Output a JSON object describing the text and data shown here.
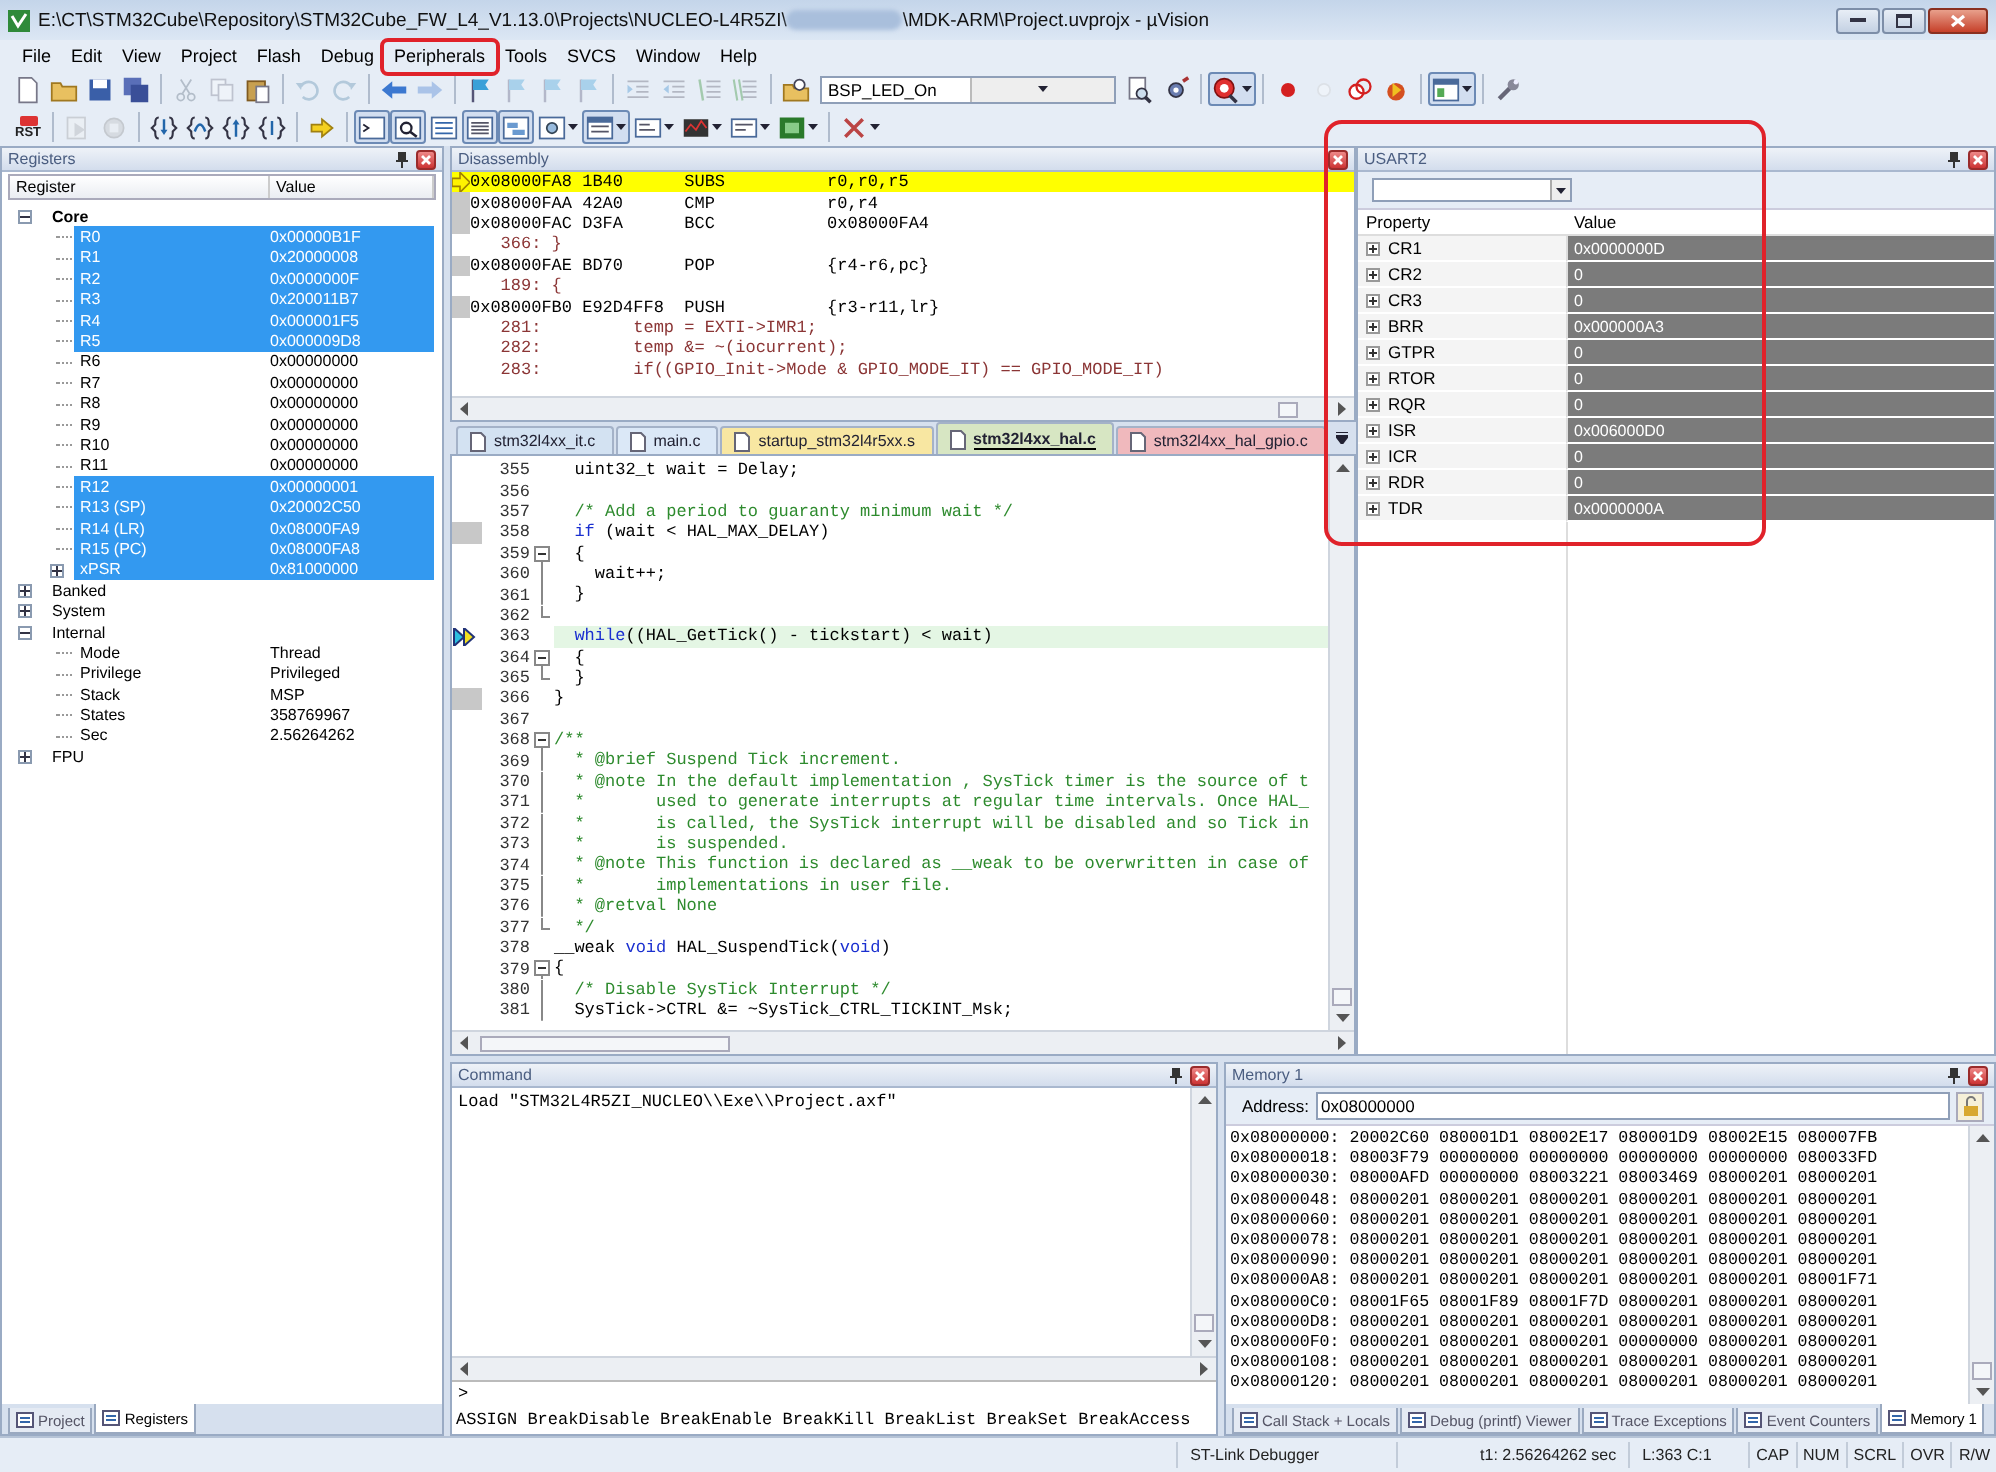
{
  "window": {
    "title_start": "E:\\CT\\STM32Cube\\Repository\\STM32Cube_FW_L4_V1.13.0\\Projects\\NUCLEO-L4R5ZI\\",
    "title_end": "\\MDK-ARM\\Project.uvprojx - µVision"
  },
  "menu": [
    {
      "label": "File",
      "highlighted": false
    },
    {
      "label": "Edit",
      "highlighted": false
    },
    {
      "label": "View",
      "highlighted": false
    },
    {
      "label": "Project",
      "highlighted": false
    },
    {
      "label": "Flash",
      "highlighted": false
    },
    {
      "label": "Debug",
      "highlighted": false
    },
    {
      "label": "Peripherals",
      "highlighted": true
    },
    {
      "label": "Tools",
      "highlighted": false
    },
    {
      "label": "SVCS",
      "highlighted": false
    },
    {
      "label": "Window",
      "highlighted": false
    },
    {
      "label": "Help",
      "highlighted": false
    }
  ],
  "toolbar_1": [
    {
      "kind": "file",
      "disabled": false,
      "pressed": false,
      "menu": false
    },
    {
      "kind": "folder",
      "disabled": false,
      "pressed": false,
      "menu": false
    },
    {
      "kind": "save",
      "disabled": false,
      "pressed": false,
      "menu": false
    },
    {
      "kind": "saveall",
      "disabled": false,
      "pressed": false,
      "menu": false
    },
    {
      "kind": "separator"
    },
    {
      "kind": "cut",
      "disabled": true,
      "pressed": false,
      "menu": false
    },
    {
      "kind": "copy",
      "disabled": true,
      "pressed": false,
      "menu": false
    },
    {
      "kind": "paste",
      "disabled": false,
      "pressed": false,
      "menu": false
    },
    {
      "kind": "separator"
    },
    {
      "kind": "undo",
      "disabled": true,
      "pressed": false,
      "menu": false
    },
    {
      "kind": "redo",
      "disabled": true,
      "pressed": false,
      "menu": false
    },
    {
      "kind": "separator"
    },
    {
      "kind": "back",
      "disabled": false,
      "pressed": false,
      "menu": false
    },
    {
      "kind": "forward",
      "disabled": true,
      "pressed": false,
      "menu": false
    },
    {
      "kind": "separator"
    },
    {
      "kind": "flag",
      "disabled": false,
      "pressed": false,
      "menu": false
    },
    {
      "kind": "flag",
      "disabled": true,
      "pressed": false,
      "menu": false
    },
    {
      "kind": "flag",
      "disabled": true,
      "pressed": false,
      "menu": false
    },
    {
      "kind": "flag",
      "disabled": true,
      "pressed": false,
      "menu": false
    },
    {
      "kind": "separator"
    },
    {
      "kind": "indent",
      "disabled": true,
      "pressed": false,
      "menu": false
    },
    {
      "kind": "outdent",
      "disabled": true,
      "pressed": false,
      "menu": false
    },
    {
      "kind": "comment",
      "disabled": true,
      "pressed": false,
      "menu": false
    },
    {
      "kind": "uncomment",
      "disabled": true,
      "pressed": false,
      "menu": false
    },
    {
      "kind": "separator"
    },
    {
      "kind": "findfiles",
      "disabled": false,
      "pressed": false,
      "menu": false
    },
    {
      "kind": "combo",
      "value": "BSP_LED_On"
    },
    {
      "kind": "find",
      "disabled": false,
      "pressed": false,
      "menu": false
    },
    {
      "kind": "gear",
      "disabled": false,
      "pressed": false,
      "menu": false
    },
    {
      "kind": "separator"
    },
    {
      "kind": "debug",
      "disabled": false,
      "pressed": true,
      "menu": true
    },
    {
      "kind": "separator"
    },
    {
      "kind": "breakpoint",
      "disabled": false,
      "pressed": false,
      "menu": false
    },
    {
      "kind": "breakpointoff",
      "disabled": true,
      "pressed": false,
      "menu": false
    },
    {
      "kind": "breakpointkill",
      "disabled": false,
      "pressed": false,
      "menu": false
    },
    {
      "kind": "breakpointclear",
      "disabled": false,
      "pressed": false,
      "menu": false
    },
    {
      "kind": "separator"
    },
    {
      "kind": "window",
      "disabled": false,
      "pressed": true,
      "menu": true
    },
    {
      "kind": "separator"
    },
    {
      "kind": "wrench",
      "disabled": false,
      "pressed": false,
      "menu": false
    }
  ],
  "toolbar_2": [
    {
      "kind": "reset",
      "label": "RST",
      "disabled": false,
      "pressed": false,
      "menu": false
    },
    {
      "kind": "separator"
    },
    {
      "kind": "run",
      "disabled": true,
      "pressed": false,
      "menu": false
    },
    {
      "kind": "stop",
      "disabled": true,
      "pressed": false,
      "menu": false
    },
    {
      "kind": "separator"
    },
    {
      "kind": "stepinto",
      "disabled": false,
      "pressed": false,
      "menu": false
    },
    {
      "kind": "stepover",
      "disabled": false,
      "pressed": false,
      "menu": false
    },
    {
      "kind": "stepout",
      "disabled": false,
      "pressed": false,
      "menu": false
    },
    {
      "kind": "runtocursor",
      "disabled": false,
      "pressed": false,
      "menu": false
    },
    {
      "kind": "separator"
    },
    {
      "kind": "nextstatement",
      "disabled": false,
      "pressed": false,
      "menu": false
    },
    {
      "kind": "separator"
    },
    {
      "kind": "cmdwindow",
      "disabled": false,
      "pressed": true,
      "menu": false
    },
    {
      "kind": "disasmwindow",
      "disabled": false,
      "pressed": true,
      "menu": false
    },
    {
      "kind": "symbols",
      "disabled": false,
      "pressed": false,
      "menu": false
    },
    {
      "kind": "regwindow",
      "disabled": false,
      "pressed": true,
      "menu": false
    },
    {
      "kind": "callstack",
      "disabled": false,
      "pressed": true,
      "menu": false
    },
    {
      "kind": "watch",
      "disabled": false,
      "pressed": false,
      "menu": true
    },
    {
      "kind": "memwindow",
      "disabled": false,
      "pressed": true,
      "menu": true
    },
    {
      "kind": "serial",
      "disabled": false,
      "pressed": false,
      "menu": true
    },
    {
      "kind": "analysis",
      "disabled": false,
      "pressed": false,
      "menu": true
    },
    {
      "kind": "trace",
      "disabled": false,
      "pressed": false,
      "menu": true
    },
    {
      "kind": "sysviewer",
      "disabled": false,
      "pressed": false,
      "menu": true
    },
    {
      "kind": "separator"
    },
    {
      "kind": "toolbox",
      "disabled": false,
      "pressed": false,
      "menu": true
    }
  ],
  "registers": {
    "title": "Registers",
    "columns": [
      "Register",
      "Value"
    ],
    "groups": [
      {
        "name": "Core",
        "expanded": true,
        "bold": true,
        "children": [
          {
            "name": "R0",
            "value": "0x00000B1F",
            "selected": true,
            "expandable": false
          },
          {
            "name": "R1",
            "value": "0x20000008",
            "selected": true,
            "expandable": false
          },
          {
            "name": "R2",
            "value": "0x0000000F",
            "selected": true,
            "expandable": false
          },
          {
            "name": "R3",
            "value": "0x200011B7",
            "selected": true,
            "expandable": false
          },
          {
            "name": "R4",
            "value": "0x000001F5",
            "selected": true,
            "expandable": false
          },
          {
            "name": "R5",
            "value": "0x000009D8",
            "selected": true,
            "expandable": false
          },
          {
            "name": "R6",
            "value": "0x00000000",
            "selected": false,
            "expandable": false
          },
          {
            "name": "R7",
            "value": "0x00000000",
            "selected": false,
            "expandable": false
          },
          {
            "name": "R8",
            "value": "0x00000000",
            "selected": false,
            "expandable": false
          },
          {
            "name": "R9",
            "value": "0x00000000",
            "selected": false,
            "expandable": false
          },
          {
            "name": "R10",
            "value": "0x00000000",
            "selected": false,
            "expandable": false
          },
          {
            "name": "R11",
            "value": "0x00000000",
            "selected": false,
            "expandable": false
          },
          {
            "name": "R12",
            "value": "0x00000001",
            "selected": true,
            "expandable": false
          },
          {
            "name": "R13 (SP)",
            "value": "0x20002C50",
            "selected": true,
            "expandable": false
          },
          {
            "name": "R14 (LR)",
            "value": "0x08000FA9",
            "selected": true,
            "expandable": false
          },
          {
            "name": "R15 (PC)",
            "value": "0x08000FA8",
            "selected": true,
            "expandable": false
          },
          {
            "name": "xPSR",
            "value": "0x81000000",
            "selected": true,
            "expandable": true
          }
        ]
      },
      {
        "name": "Banked",
        "expanded": false,
        "bold": false
      },
      {
        "name": "System",
        "expanded": false,
        "bold": false
      },
      {
        "name": "Internal",
        "expanded": true,
        "bold": false,
        "children": [
          {
            "name": "Mode",
            "value": "Thread",
            "selected": false,
            "expandable": false
          },
          {
            "name": "Privilege",
            "value": "Privileged",
            "selected": false,
            "expandable": false
          },
          {
            "name": "Stack",
            "value": "MSP",
            "selected": false,
            "expandable": false
          },
          {
            "name": "States",
            "value": "358769967",
            "selected": false,
            "expandable": false
          },
          {
            "name": "Sec",
            "value": "2.56264262",
            "selected": false,
            "expandable": false
          }
        ]
      },
      {
        "name": "FPU",
        "expanded": false,
        "bold": false
      }
    ],
    "tabs": [
      {
        "label": "Project",
        "selected": false
      },
      {
        "label": "Registers",
        "selected": true
      }
    ]
  },
  "disassembly": {
    "title": "Disassembly",
    "lines": [
      {
        "kind": "instruction",
        "text": "0x08000FA8 1B40      SUBS          r0,r0,r5",
        "current": true
      },
      {
        "kind": "instruction",
        "text": "0x08000FAA 42A0      CMP           r0,r4",
        "current": false
      },
      {
        "kind": "instruction",
        "text": "0x08000FAC D3FA      BCC           0x08000FA4",
        "current": false
      },
      {
        "kind": "source",
        "text": "   366: }"
      },
      {
        "kind": "instruction",
        "text": "0x08000FAE BD70      POP           {r4-r6,pc}",
        "current": false
      },
      {
        "kind": "source",
        "text": "   189: {"
      },
      {
        "kind": "instruction",
        "text": "0x08000FB0 E92D4FF8  PUSH          {r3-r11,lr}",
        "current": false
      },
      {
        "kind": "source",
        "text": "   281:         temp = EXTI->IMR1;"
      },
      {
        "kind": "source",
        "text": "   282:         temp &= ~(iocurrent);"
      },
      {
        "kind": "source",
        "text": "   283:         if((GPIO_Init->Mode & GPIO_MODE_IT) == GPIO_MODE_IT)"
      }
    ]
  },
  "editor": {
    "tabs": [
      {
        "label": "stm32l4xx_it.c",
        "selected": false,
        "color": "#d3e2f2"
      },
      {
        "label": "main.c",
        "selected": false,
        "color": "#dbe8f7"
      },
      {
        "label": "startup_stm32l4r5xx.s",
        "selected": false,
        "color": "#f8e7a2"
      },
      {
        "label": "stm32l4xx_hal.c",
        "selected": true,
        "color": "#d7e6c3"
      },
      {
        "label": "stm32l4xx_hal_gpio.c",
        "selected": false,
        "color": "#f0b9bd"
      }
    ],
    "lines": [
      {
        "number": "355",
        "kind": "code",
        "text": "  uint32_t wait = Delay;",
        "fold_start": false,
        "fold_line": false,
        "fold_end": false,
        "executed": false,
        "current": false
      },
      {
        "number": "356",
        "fold_start": false,
        "fold_line": false,
        "fold_end": false,
        "executed": false,
        "current": false
      },
      {
        "number": "357",
        "kind": "comment",
        "text": "  /* Add a period to guaranty minimum wait */",
        "fold_start": false,
        "fold_line": false,
        "fold_end": false,
        "executed": false,
        "current": false
      },
      {
        "number": "358",
        "kind": "code",
        "parts": [
          {
            "text": "  if",
            "kind": "keyword"
          },
          {
            "text": " (wait < HAL_MAX_DELAY)",
            "kind": "plain"
          }
        ],
        "fold_start": false,
        "fold_line": false,
        "fold_end": false,
        "executed": true,
        "current": false
      },
      {
        "number": "359",
        "kind": "code",
        "text": "  {",
        "fold_start": true,
        "fold_line": false,
        "fold_end": false,
        "executed": false,
        "current": false
      },
      {
        "number": "360",
        "kind": "code",
        "text": "    wait++;",
        "fold_start": false,
        "fold_line": true,
        "fold_end": false,
        "executed": false,
        "current": false
      },
      {
        "number": "361",
        "kind": "code",
        "text": "  }",
        "fold_start": false,
        "fold_line": true,
        "fold_end": false,
        "executed": false,
        "current": false
      },
      {
        "number": "362",
        "fold_start": false,
        "fold_line": false,
        "fold_end": true,
        "executed": false,
        "current": false
      },
      {
        "number": "363",
        "kind": "code",
        "parts": [
          {
            "text": "  while",
            "kind": "keyword"
          },
          {
            "text": "((HAL_GetTick() - tickstart) < wait)",
            "kind": "plain"
          }
        ],
        "fold_start": false,
        "fold_line": false,
        "fold_end": false,
        "executed": false,
        "current": true
      },
      {
        "number": "364",
        "kind": "code",
        "text": "  {",
        "fold_start": true,
        "fold_line": false,
        "fold_end": false,
        "executed": false,
        "current": false
      },
      {
        "number": "365",
        "kind": "code",
        "text": "  }",
        "fold_start": false,
        "fold_line": false,
        "fold_end": true,
        "executed": false,
        "current": false
      },
      {
        "number": "366",
        "kind": "code",
        "text": "}",
        "fold_start": false,
        "fold_line": false,
        "fold_end": false,
        "executed": true,
        "current": false
      },
      {
        "number": "367",
        "fold_start": false,
        "fold_line": false,
        "fold_end": false,
        "executed": false,
        "current": false
      },
      {
        "number": "368",
        "kind": "comment",
        "text": "/**",
        "fold_start": true,
        "fold_line": false,
        "fold_end": false,
        "executed": false,
        "current": false
      },
      {
        "number": "369",
        "kind": "comment",
        "text": "  * @brief Suspend Tick increment.",
        "fold_start": false,
        "fold_line": true,
        "fold_end": false,
        "executed": false,
        "current": false
      },
      {
        "number": "370",
        "kind": "comment",
        "text": "  * @note In the default implementation , SysTick timer is the source of t",
        "fold_start": false,
        "fold_line": true,
        "fold_end": false,
        "executed": false,
        "current": false
      },
      {
        "number": "371",
        "kind": "comment",
        "text": "  *       used to generate interrupts at regular time intervals. Once HAL_",
        "fold_start": false,
        "fold_line": true,
        "fold_end": false,
        "executed": false,
        "current": false
      },
      {
        "number": "372",
        "kind": "comment",
        "text": "  *       is called, the SysTick interrupt will be disabled and so Tick in",
        "fold_start": false,
        "fold_line": true,
        "fold_end": false,
        "executed": false,
        "current": false
      },
      {
        "number": "373",
        "kind": "comment",
        "text": "  *       is suspended.",
        "fold_start": false,
        "fold_line": true,
        "fold_end": false,
        "executed": false,
        "current": false
      },
      {
        "number": "374",
        "kind": "comment",
        "text": "  * @note This function is declared as __weak to be overwritten in case of",
        "fold_start": false,
        "fold_line": true,
        "fold_end": false,
        "executed": false,
        "current": false
      },
      {
        "number": "375",
        "kind": "comment",
        "text": "  *       implementations in user file.",
        "fold_start": false,
        "fold_line": true,
        "fold_end": false,
        "executed": false,
        "current": false
      },
      {
        "number": "376",
        "kind": "comment",
        "text": "  * @retval None",
        "fold_start": false,
        "fold_line": true,
        "fold_end": false,
        "executed": false,
        "current": false
      },
      {
        "number": "377",
        "kind": "comment",
        "text": "  */",
        "fold_start": false,
        "fold_line": false,
        "fold_end": true,
        "executed": false,
        "current": false
      },
      {
        "number": "378",
        "kind": "code",
        "parts": [
          {
            "text": "__weak ",
            "kind": "plain"
          },
          {
            "text": "void",
            "kind": "keyword"
          },
          {
            "text": " HAL_SuspendTick(",
            "kind": "plain"
          },
          {
            "text": "void",
            "kind": "keyword"
          },
          {
            "text": ")",
            "kind": "plain"
          }
        ],
        "fold_start": false,
        "fold_line": false,
        "fold_end": false,
        "executed": false,
        "current": false
      },
      {
        "number": "379",
        "kind": "code",
        "text": "{",
        "fold_start": true,
        "fold_line": false,
        "fold_end": false,
        "executed": false,
        "current": false
      },
      {
        "number": "380",
        "kind": "comment",
        "text": "  /* Disable SysTick Interrupt */",
        "fold_start": false,
        "fold_line": true,
        "fold_end": false,
        "executed": false,
        "current": false
      },
      {
        "number": "381",
        "kind": "code",
        "text": "  SysTick->CTRL &= ~SysTick_CTRL_TICKINT_Msk;",
        "fold_start": false,
        "fold_line": true,
        "fold_end": false,
        "executed": false,
        "current": false
      }
    ]
  },
  "usart": {
    "title": "USART2",
    "highlighted": true,
    "columns": [
      "Property",
      "Value"
    ],
    "rows": [
      {
        "name": "CR1",
        "value": "0x0000000D"
      },
      {
        "name": "CR2",
        "value": "0"
      },
      {
        "name": "CR3",
        "value": "0"
      },
      {
        "name": "BRR",
        "value": "0x000000A3"
      },
      {
        "name": "GTPR",
        "value": "0"
      },
      {
        "name": "RTOR",
        "value": "0"
      },
      {
        "name": "RQR",
        "value": "0"
      },
      {
        "name": "ISR",
        "value": "0x006000D0"
      },
      {
        "name": "ICR",
        "value": "0"
      },
      {
        "name": "RDR",
        "value": "0"
      },
      {
        "name": "TDR",
        "value": "0x0000000A"
      }
    ]
  },
  "command": {
    "title": "Command",
    "output": [
      "Load \"STM32L4R5ZI_NUCLEO\\\\Exe\\\\Project.axf\""
    ],
    "prompt": ">",
    "hint": "ASSIGN BreakDisable BreakEnable BreakKill BreakList BreakSet BreakAccess"
  },
  "memory": {
    "title": "Memory 1",
    "address_label": "Address:",
    "address": "0x08000000",
    "rows": [
      "0x08000000: 20002C60 080001D1 08002E17 080001D9 08002E15 080007FB",
      "0x08000018: 08003F79 00000000 00000000 00000000 00000000 080033FD",
      "0x08000030: 08000AFD 00000000 08003221 08003469 08000201 08000201",
      "0x08000048: 08000201 08000201 08000201 08000201 08000201 08000201",
      "0x08000060: 08000201 08000201 08000201 08000201 08000201 08000201",
      "0x08000078: 08000201 08000201 08000201 08000201 08000201 08000201",
      "0x08000090: 08000201 08000201 08000201 08000201 08000201 08000201",
      "0x080000A8: 08000201 08000201 08000201 08000201 08000201 08001F71",
      "0x080000C0: 08001F65 08001F89 08001F7D 08000201 08000201 08000201",
      "0x080000D8: 08000201 08000201 08000201 08000201 08000201 08000201",
      "0x080000F0: 08000201 08000201 08000201 00000000 08000201 08000201",
      "0x08000108: 08000201 08000201 08000201 08000201 08000201 08000201",
      "0x08000120: 08000201 08000201 08000201 08000201 08000201 08000201"
    ],
    "tabs": [
      {
        "label": "Call Stack + Locals",
        "selected": false
      },
      {
        "label": "Debug (printf) Viewer",
        "selected": false
      },
      {
        "label": "Trace Exceptions",
        "selected": false
      },
      {
        "label": "Event Counters",
        "selected": false
      },
      {
        "label": "Memory 1",
        "selected": true
      }
    ]
  },
  "status_bar": {
    "target": "ST-Link Debugger",
    "time": "t1: 2.56264262 sec",
    "position": "L:363 C:1",
    "indicators": [
      "CAP",
      "NUM",
      "SCRL",
      "OVR",
      "R/W"
    ]
  }
}
